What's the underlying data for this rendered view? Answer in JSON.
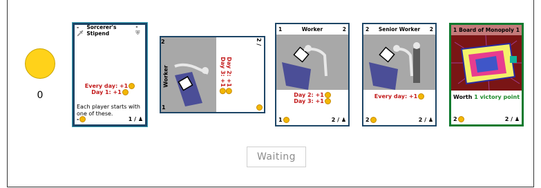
{
  "player": {
    "coin_count": "0",
    "coin_color": "#ffd21a"
  },
  "cards": [
    {
      "id": "sorcerers-stipend",
      "title": "Sorcerer's Stipend",
      "top_left": "-",
      "top_right": "-",
      "lines": [
        "Every day: +1",
        "Day 1: +1"
      ],
      "description": "Each player starts with one of these.",
      "cost": "-",
      "count": "1 /"
    },
    {
      "id": "worker-rotated",
      "title": "Worker",
      "top_left": "1",
      "top_right": "2",
      "lines": [
        "Day 2: +1",
        "Day 3: +1"
      ],
      "cost": "1",
      "count": "2 /"
    },
    {
      "id": "worker",
      "title": "Worker",
      "top_left": "1",
      "top_right": "2",
      "lines": [
        "Day 2: +1",
        "Day 3: +1"
      ],
      "cost": "1",
      "count": "2 /"
    },
    {
      "id": "senior-worker",
      "title": "Senior Worker",
      "top_left": "2",
      "top_right": "2",
      "lines": [
        "Every day: +1"
      ],
      "cost": "2",
      "count": "2 /"
    },
    {
      "id": "board-of-monopoly",
      "title": "Board of Monopoly",
      "top_left": "1",
      "top_right": "1",
      "worth_prefix": "Worth ",
      "worth_value": "1 victory point",
      "cost": "2",
      "count": "2 /"
    }
  ],
  "waiting_label": "Waiting"
}
